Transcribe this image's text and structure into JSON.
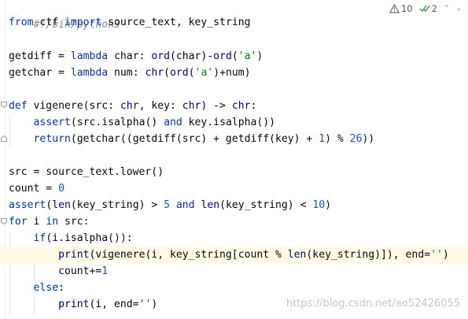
{
  "code": {
    "shebang": "#!/bin/python3",
    "l1": {
      "kw_from": "from",
      "mod": " ctf ",
      "kw_import": "import",
      "rest": " source_text, key_string"
    },
    "l3": {
      "a": "getdiff = ",
      "lambda": "lambda",
      "b": " char: ",
      "ord1": "ord",
      "c": "(char)-",
      "ord2": "ord",
      "p1": "(",
      "s": "'a'",
      "p2": ")"
    },
    "l4": {
      "a": "getchar = ",
      "lambda": "lambda",
      "b": " num: ",
      "chr": "chr",
      "p1": "(",
      "ord": "ord",
      "p2": "(",
      "s": "'a'",
      "p3": ")+num)"
    },
    "l6": {
      "def": "def",
      "a": " vigenere(src: ",
      "t1": "chr",
      "b": ", key: ",
      "t2": "chr",
      "c": ") -> ",
      "t3": "chr",
      "d": ":"
    },
    "l7": {
      "indent": "    ",
      "assert": "assert",
      "a": "(src.isalpha() ",
      "and": "and",
      "b": " key.isalpha())"
    },
    "l8": {
      "indent": "    ",
      "return": "return",
      "a": "(getchar((getdiff(src) + getdiff(key) + ",
      "n1": "1",
      "b": ") % ",
      "n2": "26",
      "c": "))"
    },
    "l10": "src = source_text.lower()",
    "l11": {
      "a": "count = ",
      "n": "0"
    },
    "l12": {
      "assert": "assert",
      "p": "(",
      "len1": "len",
      "a": "(key_string) > ",
      "n1": "5",
      "sp": " ",
      "and": "and",
      "sp2": " ",
      "len2": "len",
      "b": "(key_string) < ",
      "n2": "10",
      "c": ")"
    },
    "l13": {
      "for": "for",
      "a": " i ",
      "in": "in",
      "b": " src:"
    },
    "l14": {
      "indent": "    ",
      "if": "if",
      "a": "(i.isalpha()):"
    },
    "l15": {
      "indent": "        ",
      "print": "print",
      "a": "(vigenere(i, key_string[count % ",
      "len": "len",
      "b": "(key_string)]), end=",
      "s": "''",
      "c": ")"
    },
    "l16": {
      "indent": "        ",
      "a": "count+=",
      "n": "1"
    },
    "l17": {
      "indent": "    ",
      "else": "else",
      "a": ":"
    },
    "l18": {
      "indent": "        ",
      "print": "print",
      "a": "(i, end=",
      "s": "''",
      "c": ")"
    }
  },
  "status": {
    "warnings_count": "10",
    "weak_warnings_count": "2",
    "warning_icon": "warning-triangle-icon",
    "check_icon": "double-check-icon",
    "chevron_up": "⌃",
    "chevron_down": "⌄"
  },
  "watermark": "https://blog.csdn.net/ao52426055",
  "colors": {
    "keyword": "#0033b3",
    "string": "#067d17",
    "number": "#1750eb",
    "comment": "#8c8c8c",
    "function": "#00627a",
    "builtin": "#000080",
    "current_line": "#fffae3"
  }
}
